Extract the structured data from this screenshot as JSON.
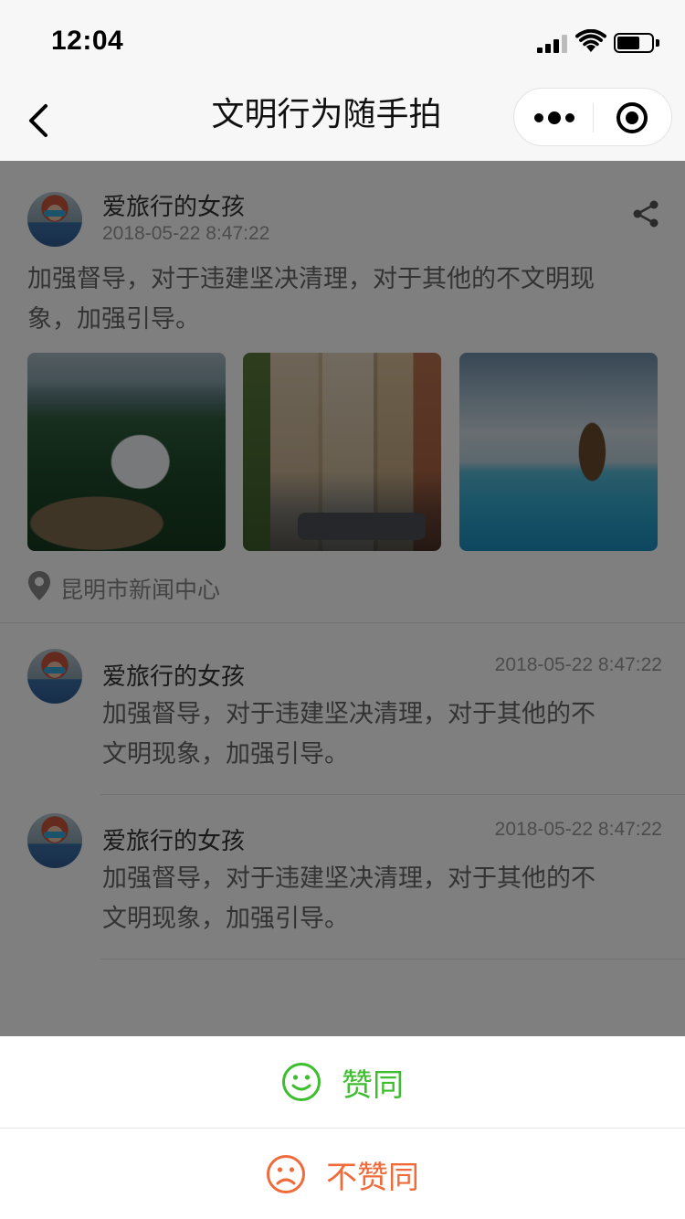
{
  "status_bar": {
    "time": "12:04"
  },
  "nav": {
    "title": "文明行为随手拍"
  },
  "post": {
    "author": "爱旅行的女孩",
    "time": "2018-05-22 8:47:22",
    "text_line1": "加强督导，对于违建坚决清理，对于其他的不文明现",
    "text_line2": "象，加强引导。",
    "location": "昆明市新闻中心",
    "photos": [
      "observatory-photo",
      "street-photo",
      "pool-photo"
    ]
  },
  "comments": [
    {
      "author": "爱旅行的女孩",
      "time": "2018-05-22 8:47:22",
      "text_line1": "加强督导，对于违建坚决清理，对于其他的不",
      "text_line2": "文明现象，加强引导。"
    },
    {
      "author": "爱旅行的女孩",
      "time": "2018-05-22 8:47:22",
      "text_line1": "加强督导，对于违建坚决清理，对于其他的不",
      "text_line2": "文明现象，加强引导。"
    }
  ],
  "sheet": {
    "agree_label": "赞同",
    "disagree_label": "不赞同",
    "agree_color": "#3ebd2f",
    "disagree_color": "#f06b3b",
    "agree_icon": "smile-icon",
    "disagree_icon": "frown-icon"
  }
}
